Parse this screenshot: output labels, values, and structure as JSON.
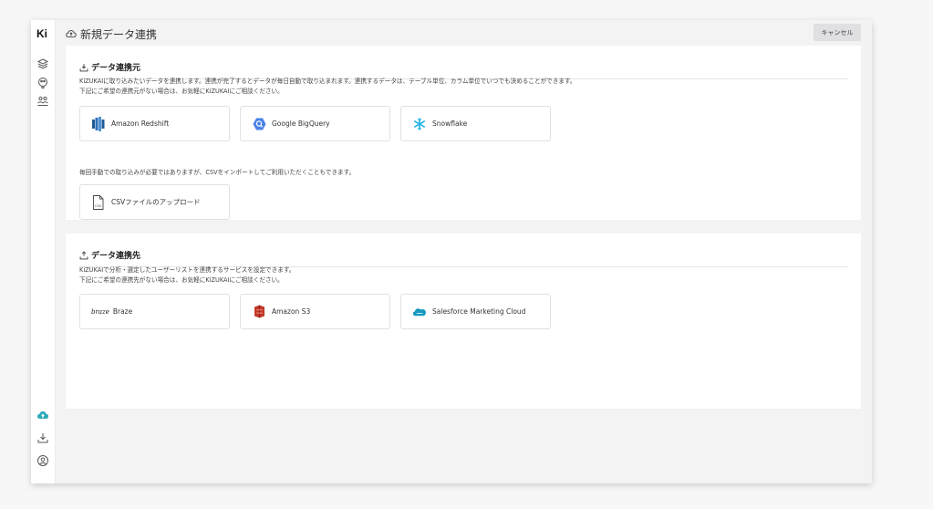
{
  "sidebar": {
    "logo": "Ki",
    "icons": [
      "layers-icon",
      "paint-icon",
      "users-icon",
      "cloud-upload-icon",
      "download-icon",
      "account-icon"
    ]
  },
  "header": {
    "title": "新規データ連携",
    "cancel_label": "キャンセル"
  },
  "source_section": {
    "title": "データ連携元",
    "desc_line1": "KiZUKAIに取り込みたいデータを連携します。連携が完了するとデータが毎日自動で取り込まれます。連携するデータは、テーブル単位、カラム単位でいつでも決めることができます。",
    "desc_line2": "下記にご希望の連携元がない場合は、お気軽にKiZUKAIにご相談ください。",
    "cards": [
      {
        "label": "Amazon Redshift",
        "icon": "redshift-icon"
      },
      {
        "label": "Google BigQuery",
        "icon": "bigquery-icon"
      },
      {
        "label": "Snowflake",
        "icon": "snowflake-icon"
      }
    ],
    "csv_note": "毎回手動での取り込みが必要ではありますが、CSVをインポートしてご利用いただくこともできます。",
    "csv_card": {
      "label": "CSVファイルのアップロード",
      "icon": "csv-file-icon",
      "icon_text": "CSV"
    }
  },
  "dest_section": {
    "title": "データ連携先",
    "desc_line1": "KiZUKAIで分析・選定したユーザーリストを連携するサービスを設定できます。",
    "desc_line2": "下記にご希望の連携先がない場合は、お気軽にKiZUKAIにご相談ください。",
    "cards": [
      {
        "label": "Braze",
        "icon": "braze-logo-icon",
        "logo_text": "braze"
      },
      {
        "label": "Amazon S3",
        "icon": "s3-icon"
      },
      {
        "label": "Salesforce Marketing Cloud",
        "icon": "salesforce-icon"
      }
    ]
  },
  "colors": {
    "accent_teal": "#2fa8b8",
    "redshift_blue": "#2d72b8",
    "bigquery_blue": "#4a82e8",
    "snowflake_cyan": "#29b5e8",
    "s3_red": "#c0392b",
    "salesforce_blue": "#1798c1"
  }
}
